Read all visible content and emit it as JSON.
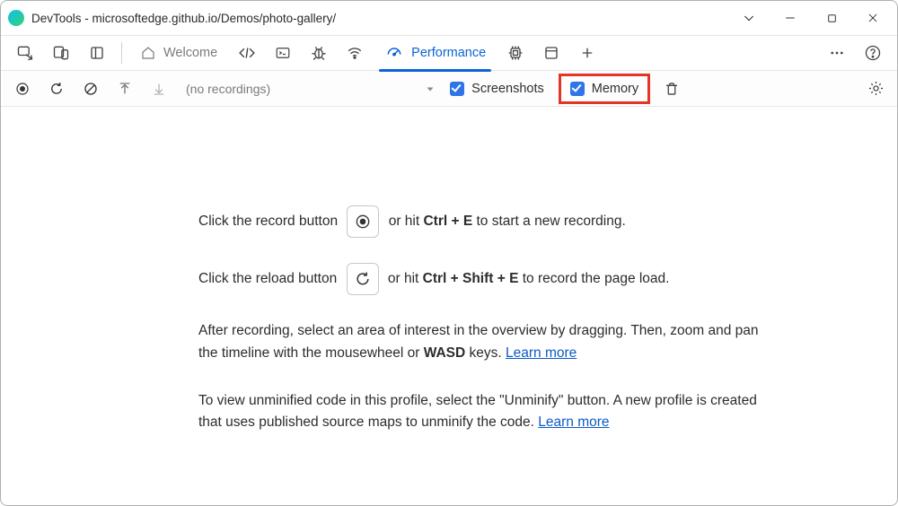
{
  "window": {
    "title": "DevTools - microsoftedge.github.io/Demos/photo-gallery/"
  },
  "tabs": {
    "welcome_label": "Welcome",
    "performance_label": "Performance"
  },
  "toolbar": {
    "recording_placeholder": "(no recordings)",
    "screenshots_label": "Screenshots",
    "memory_label": "Memory"
  },
  "help": {
    "p1_a": "Click the record button ",
    "p1_b": " or hit ",
    "p1_key": "Ctrl + E",
    "p1_c": " to start a new recording.",
    "p2_a": "Click the reload button ",
    "p2_b": " or hit ",
    "p2_key": "Ctrl + Shift + E",
    "p2_c": " to record the page load.",
    "p3_a": "After recording, select an area of interest in the overview by dragging. Then, zoom and pan the timeline with the mousewheel or ",
    "p3_key": "WASD",
    "p3_b": " keys. ",
    "p3_link": "Learn more",
    "p4_a": "To view unminified code in this profile, select the \"Unminify\" button. A new profile is created that uses published source maps to unminify the code. ",
    "p4_link": "Learn more"
  }
}
